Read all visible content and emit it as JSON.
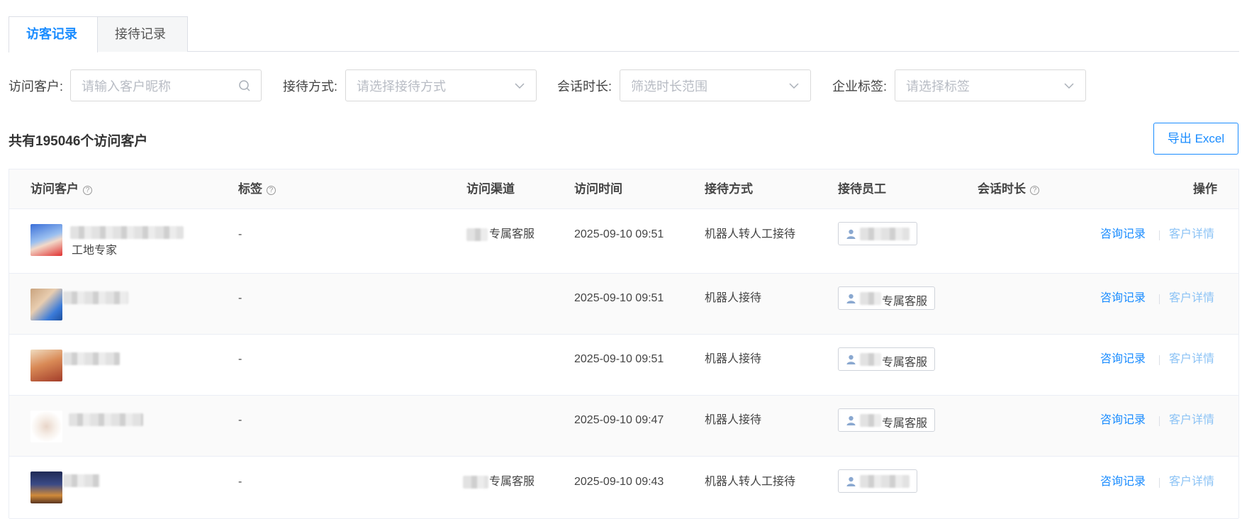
{
  "tabs": [
    {
      "label": "访客记录",
      "active": true
    },
    {
      "label": "接待记录",
      "active": false
    }
  ],
  "filters": {
    "customer": {
      "label": "访问客户:",
      "placeholder": "请输入客户昵称"
    },
    "reception": {
      "label": "接待方式:",
      "placeholder": "请选择接待方式"
    },
    "duration": {
      "label": "会话时长:",
      "placeholder": "筛选时长范围"
    },
    "tag": {
      "label": "企业标签:",
      "placeholder": "请选择标签"
    }
  },
  "summary": "共有195046个访问客户",
  "export_label": "导出 Excel",
  "columns": {
    "customer": "访问客户",
    "tags": "标签",
    "channel": "访问渠道",
    "time": "访问时间",
    "reception": "接待方式",
    "staff": "接待员工",
    "duration": "会话时长",
    "actions": "操作"
  },
  "help_glyph": "?",
  "rows": [
    {
      "customer_suffix": "工地专家",
      "tags": "-",
      "channel": "专属客服",
      "time": "2025-09-10 09:51",
      "reception": "机器人转人工接待",
      "staff": "",
      "action1": "咨询记录",
      "action2": "客户详情"
    },
    {
      "customer_suffix": "",
      "tags": "-",
      "channel": "",
      "time": "2025-09-10 09:51",
      "reception": "机器人接待",
      "staff": "专属客服",
      "action1": "咨询记录",
      "action2": "客户详情"
    },
    {
      "customer_suffix": "",
      "tags": "-",
      "channel": "",
      "time": "2025-09-10 09:51",
      "reception": "机器人接待",
      "staff": "专属客服",
      "action1": "咨询记录",
      "action2": "客户详情"
    },
    {
      "customer_suffix": "",
      "tags": "-",
      "channel": "",
      "time": "2025-09-10 09:47",
      "reception": "机器人接待",
      "staff": "专属客服",
      "action1": "咨询记录",
      "action2": "客户详情"
    },
    {
      "customer_suffix": "",
      "tags": "-",
      "channel": "专属客服",
      "time": "2025-09-10 09:43",
      "reception": "机器人转人工接待",
      "staff": "",
      "action1": "咨询记录",
      "action2": "客户详情"
    }
  ],
  "colors": {
    "accent": "#1a8cff",
    "link_secondary": "#8cc3f5"
  },
  "icons": {
    "search": "search-icon",
    "dropdown": "chevron-down-icon",
    "user": "user-icon",
    "help": "help-circle-icon"
  }
}
